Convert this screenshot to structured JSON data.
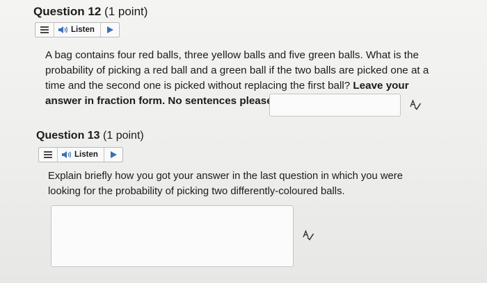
{
  "questions": [
    {
      "title": "Question 12",
      "points": "(1 point)",
      "listen_label": "Listen",
      "text_plain": "A bag contains four red balls, three yellow balls and five green balls. What is the probability of picking a red ball and a green ball if the two balls are picked one at a time and the second one is picked without replacing the first ball?",
      "text_bold": "Leave your answer in fraction form. No sentences please.",
      "answer_value": ""
    },
    {
      "title": "Question 13",
      "points": "(1 point)",
      "listen_label": "Listen",
      "text_plain": "Explain briefly how you got your answer in the last question in which you were looking for the probability of picking two differently-coloured balls.",
      "answer_value": ""
    }
  ],
  "icons": {
    "menu": "hamburger-menu-icon",
    "speaker": "speaker-icon",
    "play": "play-icon",
    "spellcheck": "spellcheck-icon"
  }
}
